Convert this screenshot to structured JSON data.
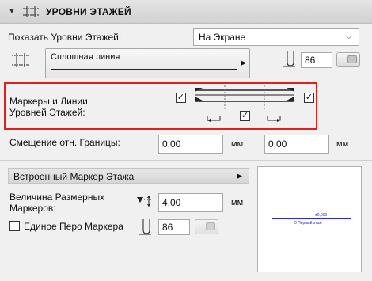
{
  "header": {
    "title": "УРОВНИ ЭТАЖЕЙ",
    "expanded_icon": "triangle-down-icon"
  },
  "show_levels": {
    "label": "Показать Уровни Этажей:",
    "value": "На Экране"
  },
  "line": {
    "type_label": "Сплошная линия",
    "pen_value": "86"
  },
  "markers": {
    "label_line1": "Маркеры и Линии",
    "label_line2": "Уровней Этажей:"
  },
  "offset": {
    "label": "Смещение отн. Границы:",
    "left_value": "0,00",
    "right_value": "0,00",
    "unit": "мм"
  },
  "builtin_marker": {
    "label": "Встроенный Маркер Этажа"
  },
  "marker_size": {
    "label_line1": "Величина Размерных",
    "label_line2": "Маркеров:",
    "value": "4,00",
    "unit": "мм"
  },
  "single_pen": {
    "label": "Единое Перо Маркера",
    "pen_value": "86"
  },
  "preview": {
    "elevation": "±0,000",
    "story_name": "0 Первый этаж"
  },
  "colors": {
    "highlight": "#e02020",
    "preview_line": "#2a2ad8"
  }
}
